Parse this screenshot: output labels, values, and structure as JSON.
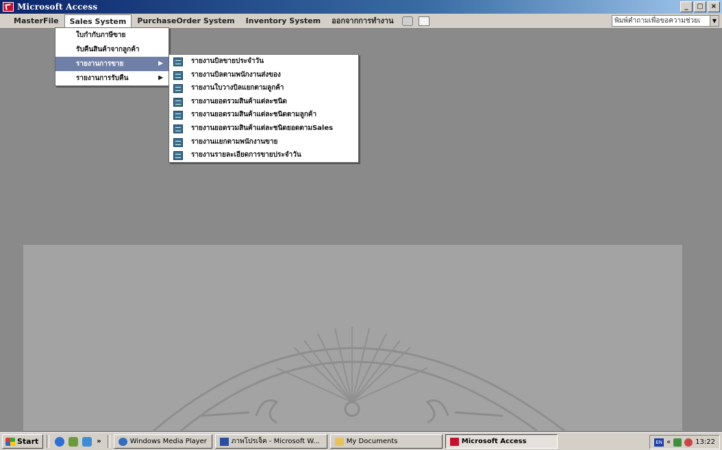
{
  "window": {
    "title": "Microsoft Access",
    "buttons": [
      "_",
      "▢",
      "×"
    ]
  },
  "menubar": {
    "items": [
      {
        "label": "MasterFile"
      },
      {
        "label": "Sales System"
      },
      {
        "label": "PurchaseOrder System"
      },
      {
        "label": "Inventory System"
      },
      {
        "label": "ออกจากการทำงาน"
      }
    ],
    "icons": [
      "printer-icon",
      "print-preview-icon"
    ],
    "combo_value": "พิมพ์คำถามเพื่อขอความช่วยเ"
  },
  "sales_menu": {
    "items": [
      {
        "label": "ใบกำกับภาษีขาย"
      },
      {
        "label": "รับคืนสินค้าจากลูกค้า"
      },
      {
        "label": "รายงานการขาย",
        "has_submenu": true,
        "selected": true
      },
      {
        "label": "รายงานการรับคืน",
        "has_submenu": true
      }
    ]
  },
  "sales_report_submenu": {
    "items": [
      {
        "label": "รายงานบิลขายประจำวัน"
      },
      {
        "label": "รายงานบิลตามพนักงานส่งของ"
      },
      {
        "label": "รายงานใบวางบิลแยกตามลูกค้า"
      },
      {
        "label": "รายงานยอดรวมสินค้าแต่ละชนิด"
      },
      {
        "label": "รายงานยอดรวมสินค้าแต่ละชนิดตามลูกค้า"
      },
      {
        "label": "รายงานยอดรวมสินค้าแต่ละชนิดยอดตามSales"
      },
      {
        "label": "รายงานแยกตามพนักงานขาย"
      },
      {
        "label": "รายงานรายละเอียดการขายประจำวัน"
      }
    ]
  },
  "taskbar": {
    "start_label": "Start",
    "overflow": "»",
    "tasks": [
      {
        "label": "Windows Media Player",
        "active": false
      },
      {
        "label": "ภาพโปรเจ็ค - Microsoft W...",
        "active": false
      },
      {
        "label": "My Documents",
        "active": false
      },
      {
        "label": "Microsoft Access",
        "active": true
      }
    ],
    "tray": {
      "lang": "EN",
      "chevron": "«",
      "clock": "13:22"
    }
  },
  "colors": {
    "desktop": "#8a8a8a",
    "menu_selected": "#6f7fa8",
    "titlebar": "#0a246a"
  }
}
